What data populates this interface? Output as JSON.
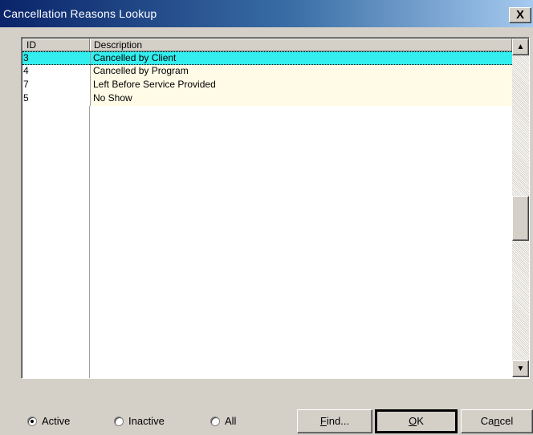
{
  "window": {
    "title": "Cancellation Reasons Lookup",
    "close_label": "X"
  },
  "grid": {
    "columns": [
      "ID",
      "Description"
    ],
    "rows": [
      {
        "id": "3",
        "description": "Cancelled by Client",
        "selected": true
      },
      {
        "id": "4",
        "description": "Cancelled by Program",
        "selected": false
      },
      {
        "id": "7",
        "description": "Left Before Service Provided",
        "selected": false
      },
      {
        "id": "5",
        "description": "No Show",
        "selected": false
      }
    ]
  },
  "scrollbar": {
    "up_glyph": "▲",
    "down_glyph": "▼"
  },
  "filter": {
    "options": [
      "Active",
      "Inactive",
      "All"
    ],
    "selected": "Active"
  },
  "buttons": {
    "find": {
      "pre": "",
      "u": "F",
      "post": "ind..."
    },
    "ok": {
      "pre": "",
      "u": "O",
      "post": "K"
    },
    "cancel": {
      "pre": "Ca",
      "u": "n",
      "post": "cel"
    }
  },
  "colors": {
    "selected_row": "#33eeee",
    "row_tint": "#fffbe6",
    "title_start": "#0a246a",
    "title_end": "#a6caf0"
  }
}
